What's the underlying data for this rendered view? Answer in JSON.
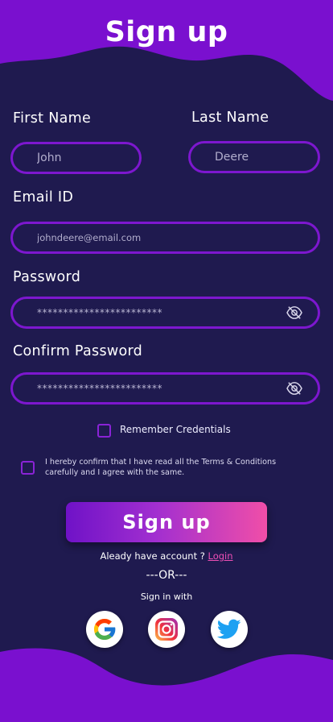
{
  "header": {
    "title": "Sign up"
  },
  "form": {
    "first_name": {
      "label": "First Name",
      "placeholder": "John"
    },
    "last_name": {
      "label": "Last Name",
      "placeholder": "Deere"
    },
    "email": {
      "label": "Email ID",
      "placeholder": "johndeere@email.com"
    },
    "password": {
      "label": "Password",
      "value": "************************"
    },
    "confirm_password": {
      "label": "Confirm Password",
      "value": "************************"
    },
    "remember_label": "Remember Credentials",
    "terms_text": "I hereby confirm that I have read all the Terms & Conditions carefully and I agree with the same.",
    "submit_label": "Sign up"
  },
  "footer": {
    "have_account_text": "Aleady have account ? ",
    "login_label": "Login",
    "or_text": "---OR---",
    "sign_in_with": "Sign in with",
    "socials": [
      "google-icon",
      "instagram-icon",
      "twitter-icon"
    ]
  },
  "colors": {
    "background": "#1f1a4f",
    "wave": "#7a10cf",
    "field_border": "#7d17cf",
    "link": "#ee4fb5"
  }
}
